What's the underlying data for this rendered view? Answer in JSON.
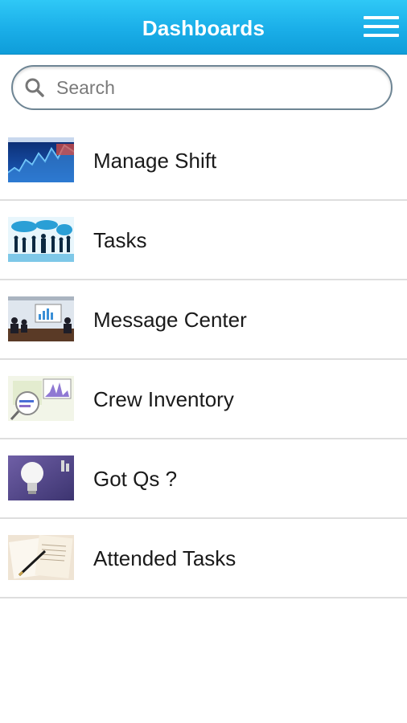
{
  "header": {
    "title": "Dashboards",
    "menu_icon": "hamburger-menu-icon"
  },
  "search": {
    "placeholder": "Search",
    "value": "",
    "icon": "search-icon"
  },
  "menu_items": [
    {
      "label": "Manage Shift",
      "thumbnail": "stock-chart-thumbnail"
    },
    {
      "label": "Tasks",
      "thumbnail": "business-people-world-map-thumbnail"
    },
    {
      "label": "Message Center",
      "thumbnail": "meeting-presentation-thumbnail"
    },
    {
      "label": "Crew Inventory",
      "thumbnail": "charts-magnifier-thumbnail"
    },
    {
      "label": "Got Qs ?",
      "thumbnail": "light-bulb-thumbnail"
    },
    {
      "label": "Attended Tasks",
      "thumbnail": "documents-pen-thumbnail"
    }
  ],
  "colors": {
    "header_top": "#2fc8f6",
    "header_bottom": "#0f9dd9",
    "divider": "#dedede",
    "search_border": "#6e8594"
  }
}
